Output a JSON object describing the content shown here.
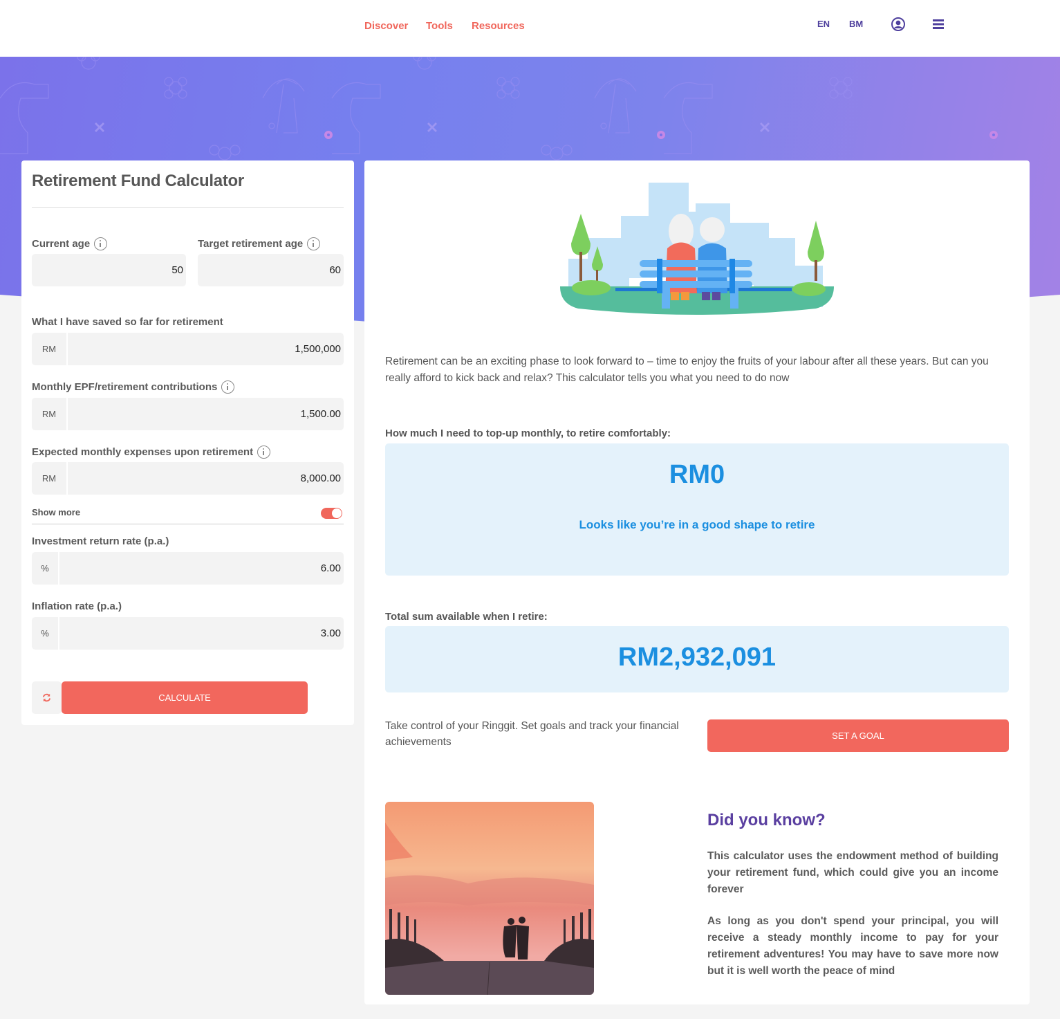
{
  "header": {
    "nav": [
      {
        "label": "Discover"
      },
      {
        "label": "Tools"
      },
      {
        "label": "Resources"
      }
    ],
    "languages": [
      "EN",
      "BM"
    ],
    "icons": {
      "account": "user-circle-icon",
      "menu": "hamburger-menu-icon"
    }
  },
  "calculator": {
    "title": "Retirement Fund Calculator",
    "fields": {
      "current_age": {
        "label": "Current age",
        "value": "50"
      },
      "target_age": {
        "label": "Target retirement age",
        "value": "60"
      },
      "saved": {
        "label": "What I have saved so far for retirement",
        "prefix": "RM",
        "value": "1,500,000"
      },
      "contributions": {
        "label": "Monthly EPF/retirement contributions",
        "prefix": "RM",
        "value": "1,500.00"
      },
      "expenses": {
        "label": "Expected monthly expenses upon retirement",
        "prefix": "RM",
        "value": "8,000.00"
      },
      "return_rate": {
        "label": "Investment return rate (p.a.)",
        "prefix": "%",
        "value": "6.00"
      },
      "inflation": {
        "label": "Inflation rate (p.a.)",
        "prefix": "%",
        "value": "3.00"
      }
    },
    "show_more": {
      "label": "Show more",
      "enabled": true
    },
    "calculate_label": "CALCULATE",
    "reset_icon": "refresh-icon"
  },
  "results": {
    "intro": "Retirement can be an exciting phase to look forward to – time to enjoy the fruits of your labour after all these years. But can you really afford to kick back and relax? This calculator tells you what you need to do now",
    "topup_label": "How much I need to top-up monthly, to retire comfortably:",
    "topup_value": "RM0",
    "topup_message": "Looks like you’re in a good shape to retire",
    "total_label": "Total sum available when I retire:",
    "total_value": "RM2,932,091",
    "goal_text": "Take control of your Ringgit. Set goals and track your financial achievements",
    "goal_button": "SET A GOAL",
    "did_you_know": {
      "title": "Did you know?",
      "paragraphs": [
        "This calculator uses the endowment method of building your retirement fund, which could give you an income forever",
        "As long as you don't spend your principal, you will receive a steady monthly income to pay for your retirement adventures! You may have to save more now but it is well worth the peace of mind"
      ]
    }
  },
  "colors": {
    "accent": "#f2675d",
    "brand_purple": "#4e3f9d",
    "result_blue": "#1b8fe0",
    "result_bg": "#e4f2fb"
  }
}
